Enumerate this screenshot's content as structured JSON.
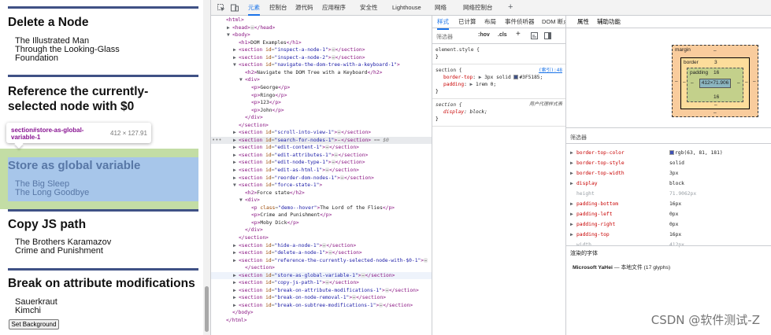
{
  "preview": {
    "sections": [
      {
        "title": "Delete a Node",
        "items": [
          "The Illustrated Man",
          "Through the Looking-Glass",
          "Foundation"
        ]
      },
      {
        "title": "Reference the currently-selected node with $0"
      },
      {
        "title": "Store as global variable",
        "items": [
          "The Big Sleep",
          "The Long Goodbye"
        ]
      },
      {
        "title": "Copy JS path",
        "items": [
          "The Brothers Karamazov",
          "Crime and Punishment"
        ]
      },
      {
        "title": "Break on attribute modifications",
        "items": [
          "Sauerkraut",
          "Kimchi"
        ]
      }
    ],
    "tooltip": {
      "selector": "section#store-as-global-variable-1",
      "dims": "412 × 127.91"
    },
    "button": "Set Background"
  },
  "toolbar": {
    "tabs": [
      "元素",
      "控制台",
      "源代码",
      "应用程序",
      "安全性",
      "Lighthouse",
      "网络",
      "网络控制台"
    ],
    "active_tab": "元素"
  },
  "elements": [
    {
      "i": 0,
      "t": "tag",
      "raw": "<html>"
    },
    {
      "i": 1,
      "t": "collapsed",
      "open": "<head>",
      "close": "</head>"
    },
    {
      "i": 1,
      "t": "open",
      "raw": "<body>"
    },
    {
      "i": 2,
      "t": "text",
      "tag": "h1",
      "text": "DOM Examples"
    },
    {
      "i": 2,
      "t": "sec",
      "id": "inspect-a-node-1"
    },
    {
      "i": 2,
      "t": "sec",
      "id": "inspect-a-node-2"
    },
    {
      "i": 2,
      "t": "secopen",
      "id": "navigate-the-dom-tree-with-a-keyboard-1"
    },
    {
      "i": 3,
      "t": "text",
      "tag": "h2",
      "text": "Navigate the DOM Tree with a Keyboard"
    },
    {
      "i": 3,
      "t": "open",
      "raw": "<div>"
    },
    {
      "i": 4,
      "t": "text",
      "tag": "p",
      "text": "George"
    },
    {
      "i": 4,
      "t": "text",
      "tag": "p",
      "text": "Ringo"
    },
    {
      "i": 4,
      "t": "text",
      "tag": "p",
      "text": "123"
    },
    {
      "i": 4,
      "t": "text",
      "tag": "p",
      "text": "John"
    },
    {
      "i": 3,
      "t": "tag",
      "raw": "</div>"
    },
    {
      "i": 2,
      "t": "tag",
      "raw": "</section>"
    },
    {
      "i": 2,
      "t": "sec",
      "id": "scroll-into-view-1"
    },
    {
      "i": 2,
      "t": "sec",
      "id": "search-for-nodes-1",
      "suffix": " == $0",
      "mark": "sel"
    },
    {
      "i": 2,
      "t": "sec",
      "id": "edit-content-1"
    },
    {
      "i": 2,
      "t": "sec",
      "id": "edit-attributes-1"
    },
    {
      "i": 2,
      "t": "sec",
      "id": "edit-node-type-1"
    },
    {
      "i": 2,
      "t": "sec",
      "id": "edit-as-html-1"
    },
    {
      "i": 2,
      "t": "sec",
      "id": "reorder-dom-nodes-1"
    },
    {
      "i": 2,
      "t": "secopen",
      "id": "force-state-1"
    },
    {
      "i": 3,
      "t": "text",
      "tag": "h2",
      "text": "Force state"
    },
    {
      "i": 3,
      "t": "open",
      "raw": "<div>"
    },
    {
      "i": 4,
      "t": "textcls",
      "tag": "p",
      "cls": "demo--hover",
      "text": "The Lord of the Flies"
    },
    {
      "i": 4,
      "t": "text",
      "tag": "p",
      "text": "Crime and Punishment"
    },
    {
      "i": 4,
      "t": "text",
      "tag": "p",
      "text": "Moby Dick"
    },
    {
      "i": 3,
      "t": "tag",
      "raw": "</div>"
    },
    {
      "i": 2,
      "t": "tag",
      "raw": "</section>"
    },
    {
      "i": 2,
      "t": "sec",
      "id": "hide-a-node-1"
    },
    {
      "i": 2,
      "t": "sec",
      "id": "delete-a-node-1"
    },
    {
      "i": 2,
      "t": "secwrap",
      "id": "reference-the-currently-selected-node-with-$0-1"
    },
    {
      "i": 3,
      "t": "tag",
      "raw": "</section>"
    },
    {
      "i": 2,
      "t": "sec",
      "id": "store-as-global-variable-1",
      "mark": "hov"
    },
    {
      "i": 2,
      "t": "sec",
      "id": "copy-js-path-1"
    },
    {
      "i": 2,
      "t": "sec",
      "id": "break-on-attribute-modifications-1"
    },
    {
      "i": 2,
      "t": "sec",
      "id": "break-on-node-removal-1"
    },
    {
      "i": 2,
      "t": "sec",
      "id": "break-on-subtree-modifications-1"
    },
    {
      "i": 1,
      "t": "tag",
      "raw": "</body>"
    },
    {
      "i": 0,
      "t": "tag",
      "raw": "</html>"
    }
  ],
  "styles": {
    "tabs": [
      "样式",
      "已计算",
      "布局",
      "事件侦听器",
      "DOM 断点",
      "属性",
      "辅助功能"
    ],
    "filter": "筛选器",
    "hov": ":hov",
    "cls": ".cls",
    "rules": [
      {
        "selector": "element.style {",
        "close": "}",
        "props": []
      },
      {
        "selector": "section {",
        "source": "(索引):48",
        "close": "}",
        "props": [
          {
            "name": "border-top",
            "value": "3px solid",
            "swatch": "#3F5185",
            "swatch_label": "#3F5185"
          },
          {
            "name": "padding",
            "value": "1rem 0;"
          }
        ]
      },
      {
        "selector": "section {",
        "source": "用户代理样式表",
        "ua": true,
        "close": "}",
        "props": [
          {
            "name": "display",
            "value": "block;"
          }
        ]
      }
    ]
  },
  "boxmodel": {
    "margin_label": "margin",
    "margin": "–",
    "border_label": "border",
    "border": "3",
    "padding_label": "padding",
    "padding": "16",
    "content": "412×71.906",
    "side": "–",
    "padding_bottom": "16",
    "border_bottom": "–",
    "margin_bottom": "–"
  },
  "computed": {
    "filter": "筛选器",
    "props": [
      {
        "name": "border-top-color",
        "value": "rgb(63, 81, 181)",
        "swatch": "#3f51b5"
      },
      {
        "name": "border-top-style",
        "value": "solid"
      },
      {
        "name": "border-top-width",
        "value": "3px"
      },
      {
        "name": "display",
        "value": "block"
      },
      {
        "name": "height",
        "value": "71.9062px",
        "dim": true
      },
      {
        "name": "padding-bottom",
        "value": "16px"
      },
      {
        "name": "padding-left",
        "value": "0px"
      },
      {
        "name": "padding-right",
        "value": "0px"
      },
      {
        "name": "padding-top",
        "value": "16px"
      },
      {
        "name": "width",
        "value": "412px",
        "dim": true
      }
    ],
    "fonts_heading": "渲染的字体",
    "font_name": "Microsoft YaHei",
    "font_detail": "— 本地文件 (17 glyphs)"
  },
  "watermark": "CSDN @软件测试-Z"
}
